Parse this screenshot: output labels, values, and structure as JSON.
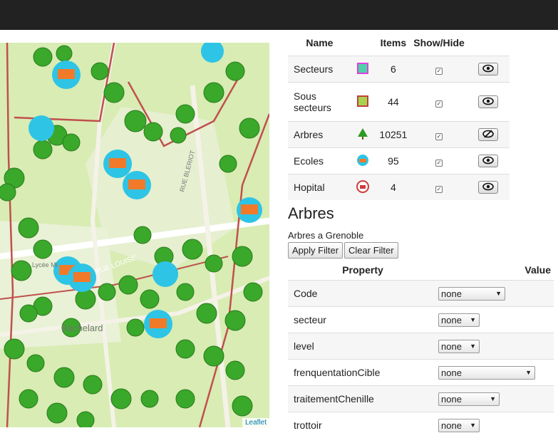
{
  "map": {
    "attribution": "Leaflet",
    "labels": [
      "RUE BLERIOT",
      "RUE LOUISE",
      "Bachelard",
      "Lycée Mi"
    ]
  },
  "layers": {
    "headers": {
      "name": "Name",
      "items": "Items",
      "show_hide": "Show/Hide"
    },
    "rows": [
      {
        "name": "Secteurs",
        "count": "6",
        "icon": "magenta-square-swatch-icon",
        "color": "#e040e0",
        "fill": "#4dd2a8"
      },
      {
        "name": "Sous secteurs",
        "count": "44",
        "icon": "red-square-swatch-icon",
        "color": "#c04040",
        "fill": "#a8d24d"
      },
      {
        "name": "Arbres",
        "count": "10251",
        "icon": "tree-icon"
      },
      {
        "name": "Ecoles",
        "count": "95",
        "icon": "school-icon"
      },
      {
        "name": "Hopital",
        "count": "4",
        "icon": "hospital-icon"
      }
    ]
  },
  "section": {
    "title": "Arbres",
    "description": "Arbres a Grenoble",
    "apply_label": "Apply Filter",
    "clear_label": "Clear Filter"
  },
  "props": {
    "headers": {
      "property": "Property",
      "value": "Value"
    },
    "rows": [
      {
        "name": "Code",
        "value": "none"
      },
      {
        "name": "secteur",
        "value": "none"
      },
      {
        "name": "level",
        "value": "none"
      },
      {
        "name": "frenquentationCible",
        "value": "none"
      },
      {
        "name": "traitementChenille",
        "value": "none"
      },
      {
        "name": "trottoir",
        "value": "none"
      }
    ]
  }
}
